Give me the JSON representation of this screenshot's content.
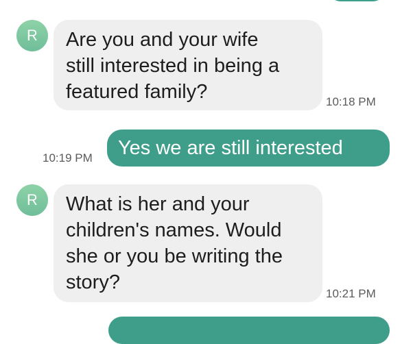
{
  "thread": {
    "contact_initial": "R",
    "messages": [
      {
        "direction": "incoming",
        "lines": [
          "Are you and your wife",
          "still interested in being a",
          "featured family?"
        ],
        "time": "10:18 PM"
      },
      {
        "direction": "outgoing",
        "text": "Yes we are still interested",
        "time": "10:19 PM"
      },
      {
        "direction": "incoming",
        "lines": [
          "What is her and your",
          "children's names. Would",
          "she or you be writing the",
          "story?"
        ],
        "time": "10:21 PM"
      }
    ]
  },
  "colors": {
    "incoming_bubble": "#efefef",
    "outgoing_bubble": "#3f9e8a",
    "avatar": "#7cc79f",
    "timestamp": "#5a5a5a"
  }
}
